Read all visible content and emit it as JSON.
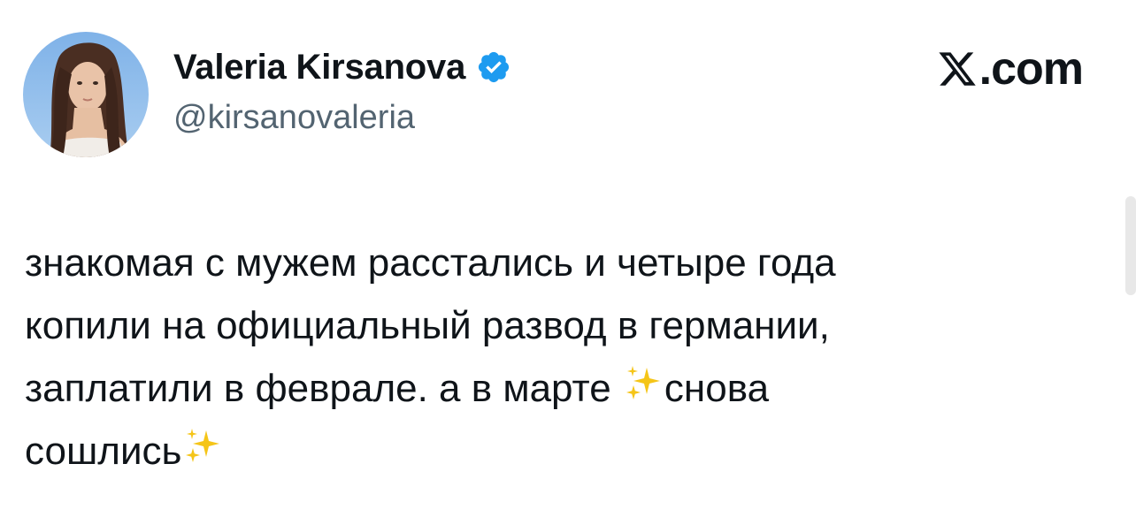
{
  "author": {
    "display_name": "Valeria Kirsanova",
    "handle": "@kirsanovaleria",
    "verified": true,
    "avatar_icon": "profile-photo"
  },
  "site": {
    "logo_icon": "x-logo-icon",
    "text": ".com"
  },
  "tweet": {
    "line1": "знакомая с мужем расстались и четыре года",
    "line2": "копили на официальный развод в германии,",
    "line3_a": "заплатили в феврале. а в марте ",
    "line3_b": "снова",
    "line4": "сошлись",
    "emoji": "sparkles-emoji"
  },
  "colors": {
    "text_primary": "#0f1419",
    "text_secondary": "#536471",
    "verified_blue": "#1d9bf0",
    "sparkle_gold": "#f5c518"
  }
}
